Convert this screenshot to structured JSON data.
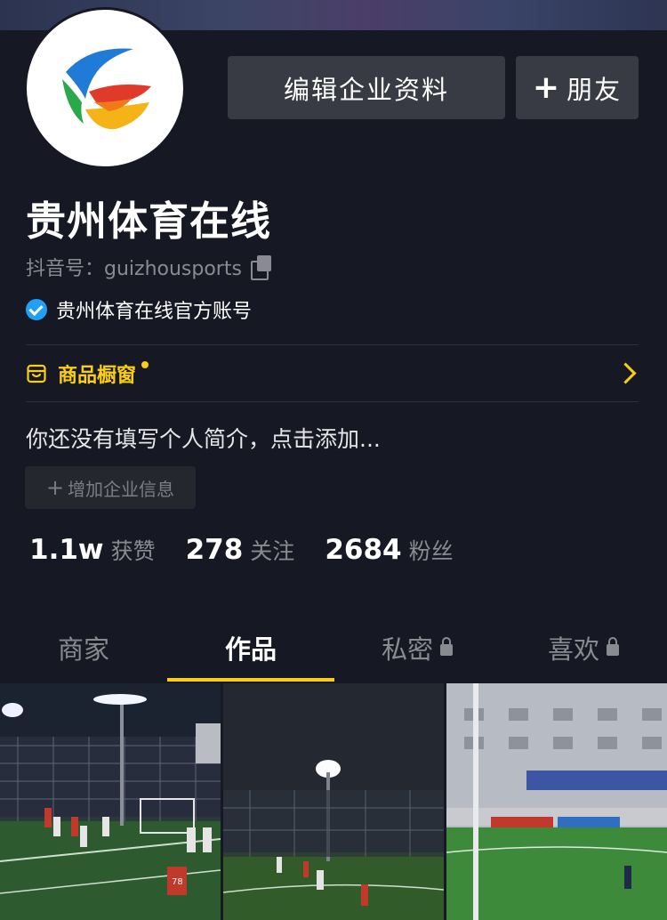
{
  "profile": {
    "name": "贵州体育在线",
    "account_id": "抖音号：guizhousports",
    "verification": "贵州体育在线官方账号",
    "bio_placeholder": "你还没有填写个人简介，点击添加..."
  },
  "actions": {
    "edit_label": "编辑企业资料",
    "friend_label": "朋友",
    "friend_plus": "+"
  },
  "shop": {
    "label": "商品橱窗"
  },
  "add_info": {
    "plus": "+",
    "label": "增加企业信息"
  },
  "stats": [
    {
      "number": "1.1w",
      "label": "获赞"
    },
    {
      "number": "278",
      "label": "关注"
    },
    {
      "number": "2684",
      "label": "粉丝"
    }
  ],
  "tabs": [
    {
      "label": "商家",
      "locked": false,
      "active": false
    },
    {
      "label": "作品",
      "locked": false,
      "active": true
    },
    {
      "label": "私密",
      "locked": true,
      "active": false
    },
    {
      "label": "喜欢",
      "locked": true,
      "active": false
    }
  ],
  "thumbnails": [
    {
      "jersey_text": "78"
    },
    {
      "jersey_text": ""
    },
    {
      "jersey_text": ""
    }
  ],
  "colors": {
    "background": "#161823",
    "accent": "#face15",
    "verified_blue": "#20a0f7",
    "button_bg": "#393b44"
  }
}
